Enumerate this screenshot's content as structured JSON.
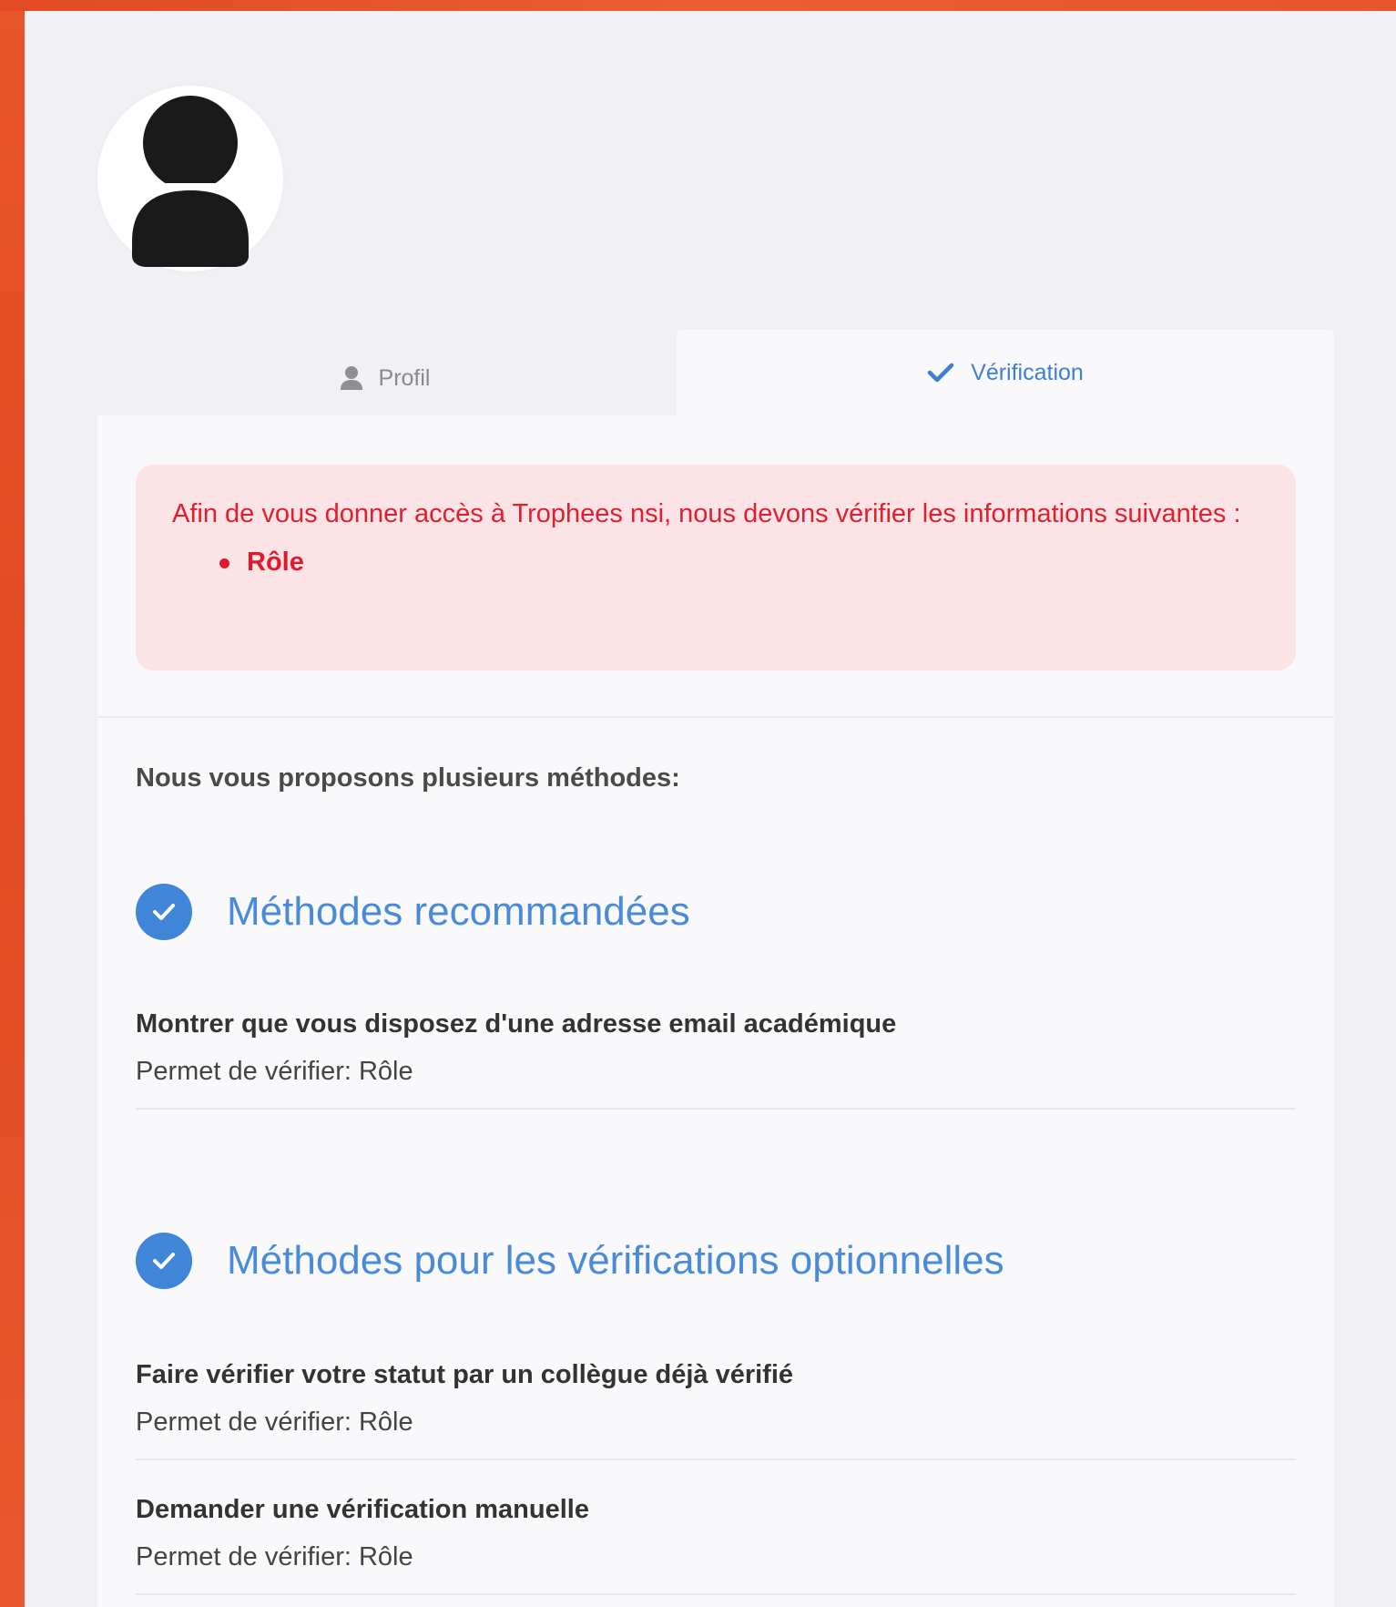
{
  "tabs": {
    "profile": {
      "label": "Profil",
      "icon": "user-icon"
    },
    "verification": {
      "label": "Vérification",
      "icon": "check-icon"
    }
  },
  "alert": {
    "text": "Afin de vous donner accès à Trophees nsi, nous devons vérifier les informations suivantes :",
    "items": [
      "Rôle"
    ]
  },
  "intro": "Nous vous proposons plusieurs méthodes:",
  "sections": [
    {
      "title": "Méthodes recommandées",
      "methods": [
        {
          "title": "Montrer que vous disposez d'une adresse email académique",
          "subtitle": "Permet de vérifier: Rôle"
        }
      ]
    },
    {
      "title": "Méthodes pour les vérifications optionnelles",
      "methods": [
        {
          "title": "Faire vérifier votre statut par un collègue déjà vérifié",
          "subtitle": "Permet de vérifier: Rôle"
        },
        {
          "title": "Demander une vérification manuelle",
          "subtitle": "Permet de vérifier: Rôle"
        }
      ]
    }
  ],
  "colors": {
    "frame": "#e8542a",
    "accent_blue": "#3f86d8",
    "alert_bg": "#fce4e6",
    "alert_text": "#e0202f"
  }
}
